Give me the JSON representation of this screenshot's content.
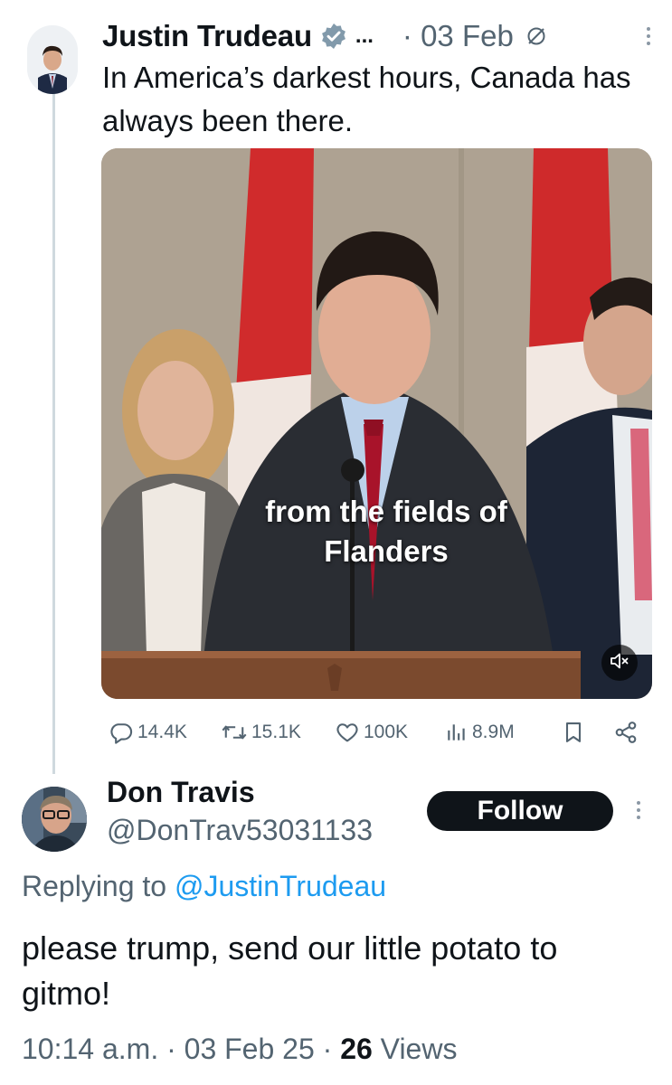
{
  "post": {
    "author_name": "Justin Trudeau",
    "more_text": "...",
    "date": "· 03 Feb",
    "text": "In America’s darkest hours, Canada has always been there.",
    "video_caption": "from the fields of Flanders",
    "stats": {
      "replies": "14.4K",
      "reposts": "15.1K",
      "likes": "100K",
      "views": "8.9M"
    }
  },
  "reply": {
    "author_name": "Don Travis",
    "handle": "@DonTrav53031133",
    "follow_label": "Follow",
    "replying_to_prefix": "Replying to",
    "replying_to_handle": "@JustinTrudeau",
    "text": "please trump, send our little potato to gitmo!",
    "time": "10:14 a.m. · 03 Feb 25 ·",
    "views_count": "26",
    "views_label": "Views"
  },
  "colors": {
    "secondary_text": "#536471",
    "link_blue": "#1d9bf0",
    "follow_bg": "#0f1419",
    "thread_line": "#cfd9de"
  },
  "icons": [
    "verified-badge-icon",
    "edited-icon",
    "more-vertical-icon",
    "reply-icon",
    "repost-icon",
    "like-icon",
    "views-icon",
    "bookmark-icon",
    "share-icon",
    "mute-icon"
  ]
}
